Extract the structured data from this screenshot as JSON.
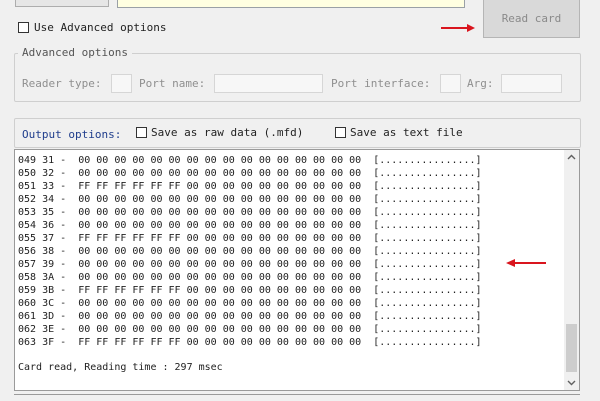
{
  "top": {
    "use_advanced_label": "Use Advanced options",
    "read_card_label": "Read card"
  },
  "advanced": {
    "legend": "Advanced options",
    "reader_type_label": "Reader type:",
    "port_name_label": "Port name:",
    "port_interface_label": "Port interface:",
    "arg_label": "Arg:"
  },
  "output": {
    "label": "Output options:",
    "save_raw_label": "Save as raw data (.mfd)",
    "save_text_label": "Save as text file"
  },
  "hex_lines": [
    "049 31 -  00 00 00 00 00 00 00 00 00 00 00 00 00 00 00 00  [................]",
    "050 32 -  00 00 00 00 00 00 00 00 00 00 00 00 00 00 00 00  [................]",
    "051 33 -  FF FF FF FF FF FF 00 00 00 00 00 00 00 00 00 00  [................]",
    "052 34 -  00 00 00 00 00 00 00 00 00 00 00 00 00 00 00 00  [................]",
    "053 35 -  00 00 00 00 00 00 00 00 00 00 00 00 00 00 00 00  [................]",
    "054 36 -  00 00 00 00 00 00 00 00 00 00 00 00 00 00 00 00  [................]",
    "055 37 -  FF FF FF FF FF FF 00 00 00 00 00 00 00 00 00 00  [................]",
    "056 38 -  00 00 00 00 00 00 00 00 00 00 00 00 00 00 00 00  [................]",
    "057 39 -  00 00 00 00 00 00 00 00 00 00 00 00 00 00 00 00  [................]",
    "058 3A -  00 00 00 00 00 00 00 00 00 00 00 00 00 00 00 00  [................]",
    "059 3B -  FF FF FF FF FF FF 00 00 00 00 00 00 00 00 00 00  [................]",
    "060 3C -  00 00 00 00 00 00 00 00 00 00 00 00 00 00 00 00  [................]",
    "061 3D -  00 00 00 00 00 00 00 00 00 00 00 00 00 00 00 00  [................]",
    "062 3E -  00 00 00 00 00 00 00 00 00 00 00 00 00 00 00 00  [................]",
    "063 3F -  FF FF FF FF FF FF 00 00 00 00 00 00 00 00 00 00  [................]"
  ],
  "status_line": "Card read, Reading time : 297 msec",
  "colors": {
    "annotation_arrow": "#d9151e",
    "label_blue": "#1f3d8c",
    "yellow_field": "#ffffe1"
  },
  "icons": {
    "scroll_up": "chevron-up-icon",
    "scroll_down": "chevron-down-icon",
    "annotation": "red-arrow-icon"
  }
}
